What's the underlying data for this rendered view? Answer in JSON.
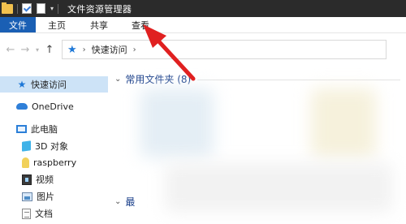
{
  "window": {
    "title": "文件资源管理器"
  },
  "ribbon": {
    "tabs": [
      {
        "label": "文件"
      },
      {
        "label": "主页"
      },
      {
        "label": "共享"
      },
      {
        "label": "查看"
      }
    ]
  },
  "address": {
    "path": [
      "快速访问"
    ]
  },
  "navpane": {
    "items": [
      {
        "label": "快速访问",
        "icon": "quick-access-star-icon",
        "selected": true
      },
      {
        "label": "OneDrive",
        "icon": "onedrive-cloud-icon"
      },
      {
        "label": "此电脑",
        "icon": "computer-icon"
      },
      {
        "label": "3D 对象",
        "icon": "3d-objects-icon"
      },
      {
        "label": "raspberry",
        "icon": "raspberry-drive-icon"
      },
      {
        "label": "视频",
        "icon": "video-folder-icon"
      },
      {
        "label": "图片",
        "icon": "pictures-folder-icon"
      },
      {
        "label": "文档",
        "icon": "documents-folder-icon"
      }
    ]
  },
  "content": {
    "group_frequent": "常用文件夹 (8)",
    "group_recent": "最"
  },
  "colors": {
    "file_tab": "#1a5fb4",
    "selection": "#cde3f7",
    "annotation_arrow": "#e02020"
  }
}
